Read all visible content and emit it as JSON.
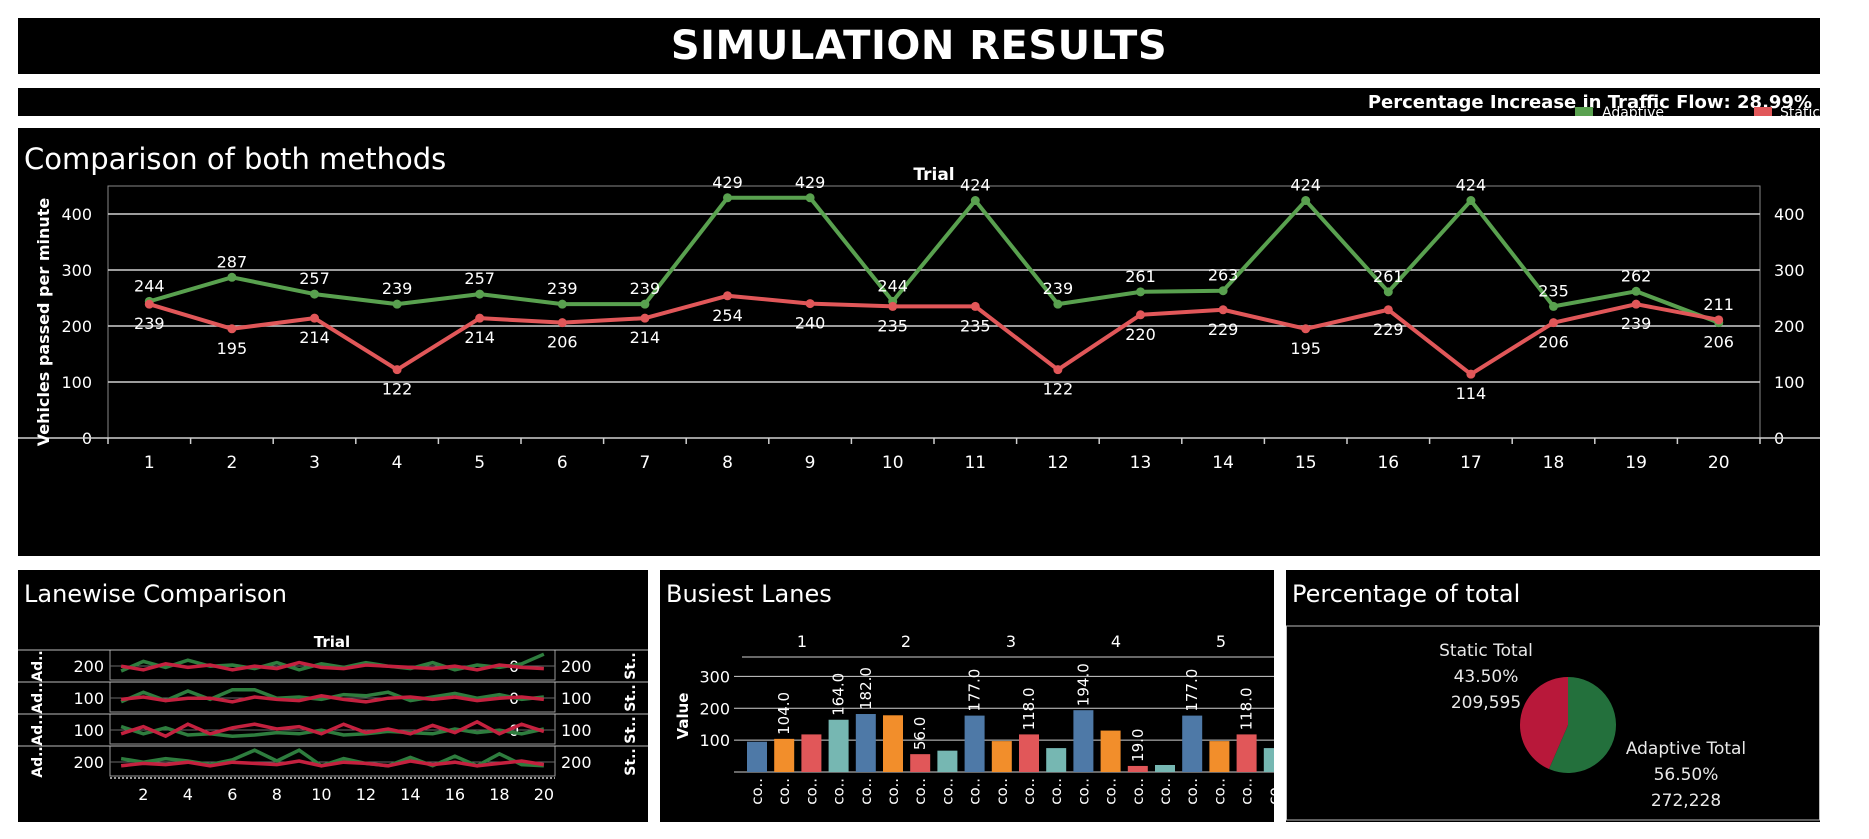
{
  "page": {
    "title": "SIMULATION RESULTS"
  },
  "info": {
    "percentage_text": "Percentage Increase in Traffic Flow: 28.99%",
    "legend": [
      {
        "label": "Adaptive",
        "color": "#59a14f"
      },
      {
        "label": "Static",
        "color": "#e15759"
      }
    ]
  },
  "colors": {
    "adaptive": "#59a14f",
    "static": "#e15759",
    "adaptive_dark": "#2e7d3e",
    "static_dark": "#c4213f",
    "blue": "#4e79a7",
    "orange": "#f28e2b",
    "red": "#e15759",
    "teal": "#76b7b2",
    "pie_adaptive": "#23703c",
    "pie_static": "#b8183a"
  },
  "panels": {
    "comparison": "Comparison of both methods",
    "lanewise": "Lanewise Comparison",
    "busiest": "Busiest Lanes",
    "percentage": "Percentage of total"
  },
  "chart_data": [
    {
      "type": "line",
      "title": "Comparison of both methods",
      "xlabel": "Trial",
      "ylabel": "Vehicles passed per minute",
      "x": [
        1,
        2,
        3,
        4,
        5,
        6,
        7,
        8,
        9,
        10,
        11,
        12,
        13,
        14,
        15,
        16,
        17,
        18,
        19,
        20
      ],
      "ylim": [
        0,
        450
      ],
      "yticks": [
        0,
        100,
        200,
        300,
        400
      ],
      "grid": true,
      "series": [
        {
          "name": "Adaptive",
          "values": [
            244,
            287,
            257,
            239,
            257,
            239,
            239,
            429,
            429,
            244,
            424,
            239,
            261,
            263,
            424,
            261,
            424,
            235,
            262,
            206
          ]
        },
        {
          "name": "Static",
          "values": [
            239,
            195,
            214,
            122,
            214,
            206,
            214,
            254,
            240,
            235,
            235,
            122,
            220,
            229,
            195,
            229,
            114,
            206,
            239,
            211
          ]
        }
      ]
    },
    {
      "type": "line",
      "title": "Lanewise Comparison",
      "xlabel": "Trial",
      "left_row_labels": [
        "Ad..",
        "Ad..",
        "Ad..",
        "Ad.."
      ],
      "right_row_labels": [
        "St..",
        "St..",
        "St..",
        "St.."
      ],
      "left_ticks": [
        "200",
        "100",
        "100",
        "200"
      ],
      "right_ticks": [
        "200",
        "100",
        "100",
        "200"
      ],
      "inner_ticks": [
        "0",
        "0",
        "0"
      ],
      "xticks": [
        2,
        4,
        6,
        8,
        10,
        12,
        14,
        16,
        18,
        20
      ],
      "rows": [
        {
          "adaptive": [
            0.25,
            0.65,
            0.4,
            0.7,
            0.45,
            0.5,
            0.35,
            0.6,
            0.3,
            0.55,
            0.4,
            0.6,
            0.45,
            0.35,
            0.6,
            0.3,
            0.5,
            0.4,
            0.55,
            0.95
          ],
          "static": [
            0.45,
            0.3,
            0.55,
            0.4,
            0.5,
            0.3,
            0.45,
            0.35,
            0.6,
            0.4,
            0.35,
            0.5,
            0.45,
            0.4,
            0.35,
            0.45,
            0.3,
            0.5,
            0.4,
            0.35
          ]
        },
        {
          "adaptive": [
            0.3,
            0.7,
            0.35,
            0.75,
            0.4,
            0.8,
            0.8,
            0.45,
            0.5,
            0.4,
            0.6,
            0.55,
            0.7,
            0.35,
            0.5,
            0.65,
            0.45,
            0.6,
            0.4,
            0.5
          ],
          "static": [
            0.4,
            0.5,
            0.35,
            0.45,
            0.45,
            0.3,
            0.5,
            0.4,
            0.35,
            0.55,
            0.4,
            0.3,
            0.45,
            0.5,
            0.4,
            0.5,
            0.35,
            0.45,
            0.5,
            0.4
          ]
        },
        {
          "adaptive": [
            0.6,
            0.3,
            0.55,
            0.25,
            0.3,
            0.2,
            0.25,
            0.35,
            0.3,
            0.45,
            0.25,
            0.3,
            0.4,
            0.35,
            0.3,
            0.5,
            0.35,
            0.45,
            0.3,
            0.5
          ],
          "static": [
            0.3,
            0.6,
            0.2,
            0.7,
            0.3,
            0.55,
            0.7,
            0.5,
            0.6,
            0.3,
            0.7,
            0.35,
            0.5,
            0.3,
            0.65,
            0.35,
            0.8,
            0.3,
            0.7,
            0.4
          ]
        },
        {
          "adaptive": [
            0.6,
            0.45,
            0.6,
            0.5,
            0.35,
            0.55,
            0.95,
            0.5,
            0.95,
            0.3,
            0.6,
            0.4,
            0.3,
            0.65,
            0.3,
            0.7,
            0.3,
            0.8,
            0.35,
            0.3
          ],
          "static": [
            0.3,
            0.4,
            0.35,
            0.45,
            0.3,
            0.45,
            0.4,
            0.35,
            0.5,
            0.3,
            0.45,
            0.4,
            0.3,
            0.5,
            0.35,
            0.45,
            0.3,
            0.4,
            0.5,
            0.35
          ]
        }
      ]
    },
    {
      "type": "bar",
      "title": "Busiest Lanes",
      "ylabel": "Value",
      "ylim": [
        0,
        400
      ],
      "yticks": [
        100,
        200,
        300
      ],
      "groups": [
        "1",
        "2",
        "3",
        "4",
        "5"
      ],
      "bar_label": "co..",
      "bars": [
        {
          "group": "1",
          "values": [
            95,
            104,
            118
          ]
        },
        {
          "group": "2",
          "values": [
            164,
            182,
            178,
            56,
            67
          ]
        },
        {
          "group": "3",
          "values": [
            177,
            97,
            118,
            75
          ]
        },
        {
          "group": "4",
          "values": [
            194,
            130,
            19,
            22
          ]
        },
        {
          "group": "5",
          "values": [
            177,
            97,
            118,
            75
          ]
        }
      ],
      "data_labels": [
        {
          "group": "1",
          "index": 1,
          "text": "104.0"
        },
        {
          "group": "2",
          "index": 0,
          "text": "164.0"
        },
        {
          "group": "2",
          "index": 1,
          "text": "182.0"
        },
        {
          "group": "2",
          "index": 3,
          "text": "56.0"
        },
        {
          "group": "3",
          "index": 0,
          "text": "177.0"
        },
        {
          "group": "3",
          "index": 2,
          "text": "118.0"
        },
        {
          "group": "4",
          "index": 0,
          "text": "194.0"
        },
        {
          "group": "4",
          "index": 2,
          "text": "19.0"
        },
        {
          "group": "5",
          "index": 0,
          "text": "177.0"
        },
        {
          "group": "5",
          "index": 2,
          "text": "118.0"
        }
      ]
    },
    {
      "type": "pie",
      "title": "Percentage of total",
      "slices": [
        {
          "name": "Adaptive Total",
          "percent": "56.50%",
          "value_text": "272,228",
          "value": 56.5
        },
        {
          "name": "Static Total",
          "percent": "43.50%",
          "value_text": "209,595",
          "value": 43.5
        }
      ]
    }
  ]
}
